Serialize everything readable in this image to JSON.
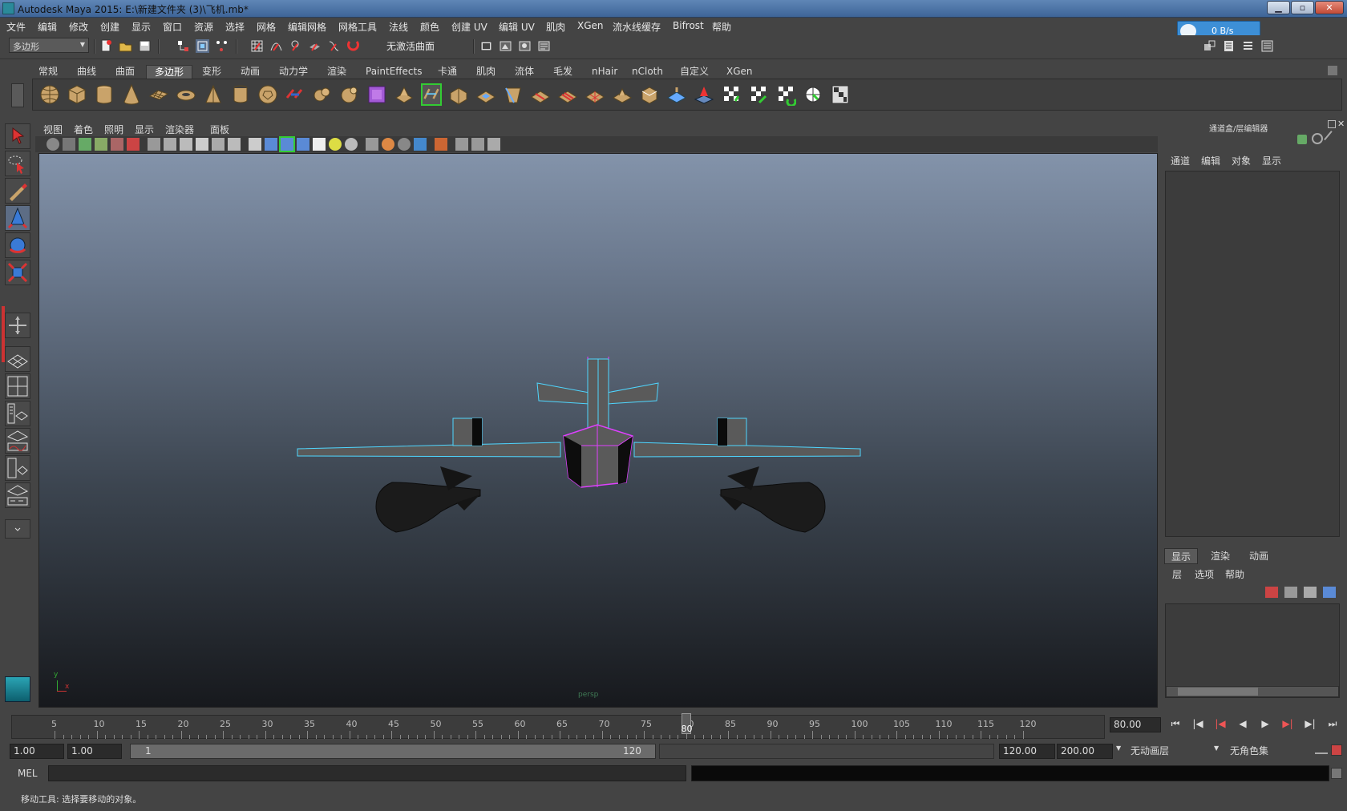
{
  "window": {
    "title": "Autodesk Maya 2015: E:\\新建文件夹 (3)\\飞机.mb*",
    "minimize": "▁",
    "maximize": "▫",
    "close": "✕"
  },
  "menubar": {
    "items": [
      "文件",
      "编辑",
      "修改",
      "创建",
      "显示",
      "窗口",
      "资源",
      "选择",
      "网格",
      "编辑网格",
      "网格工具",
      "法线",
      "颜色",
      "创建 UV",
      "编辑 UV",
      "肌肉",
      "XGen",
      "流水线缓存",
      "Bifrost",
      "帮助"
    ]
  },
  "statusline": {
    "menu_set": "多边形",
    "live_surface": "无激活曲面"
  },
  "net_speed": {
    "value": "0 B/s"
  },
  "shelf": {
    "tabs": [
      "常规",
      "曲线",
      "曲面",
      "多边形",
      "变形",
      "动画",
      "动力学",
      "渲染",
      "PaintEffects",
      "卡通",
      "肌肉",
      "流体",
      "毛发",
      "nHair",
      "nCloth",
      "自定义",
      "XGen"
    ],
    "active_tab": "多边形"
  },
  "viewport": {
    "menu": [
      "视图",
      "着色",
      "照明",
      "显示",
      "渲染器",
      "面板"
    ],
    "camera_label": "persp",
    "axis_y": "y",
    "axis_x": "x"
  },
  "channel_box": {
    "title": "通道盒/层编辑器",
    "menu": [
      "通道",
      "编辑",
      "对象",
      "显示"
    ]
  },
  "layer_editor": {
    "tabs": [
      "显示",
      "渲染",
      "动画"
    ],
    "active_tab": "显示",
    "menu": [
      "层",
      "选项",
      "帮助"
    ]
  },
  "timeline": {
    "ticks": [
      "5",
      "10",
      "15",
      "20",
      "25",
      "30",
      "35",
      "40",
      "45",
      "50",
      "55",
      "60",
      "65",
      "70",
      "75",
      "80",
      "85",
      "90",
      "95",
      "100",
      "105",
      "110",
      "115",
      "120"
    ],
    "current_frame": "80",
    "current_time": "80.00"
  },
  "range": {
    "start_time": "1.00",
    "playback_start": "1.00",
    "range_start": "1",
    "range_end": "120",
    "playback_end": "120.00",
    "end_time": "200.00",
    "anim_layer": "无动画层",
    "char_set": "无角色集"
  },
  "mel": {
    "label": "MEL"
  },
  "help": {
    "text": "移动工具: 选择要移动的对象。"
  }
}
